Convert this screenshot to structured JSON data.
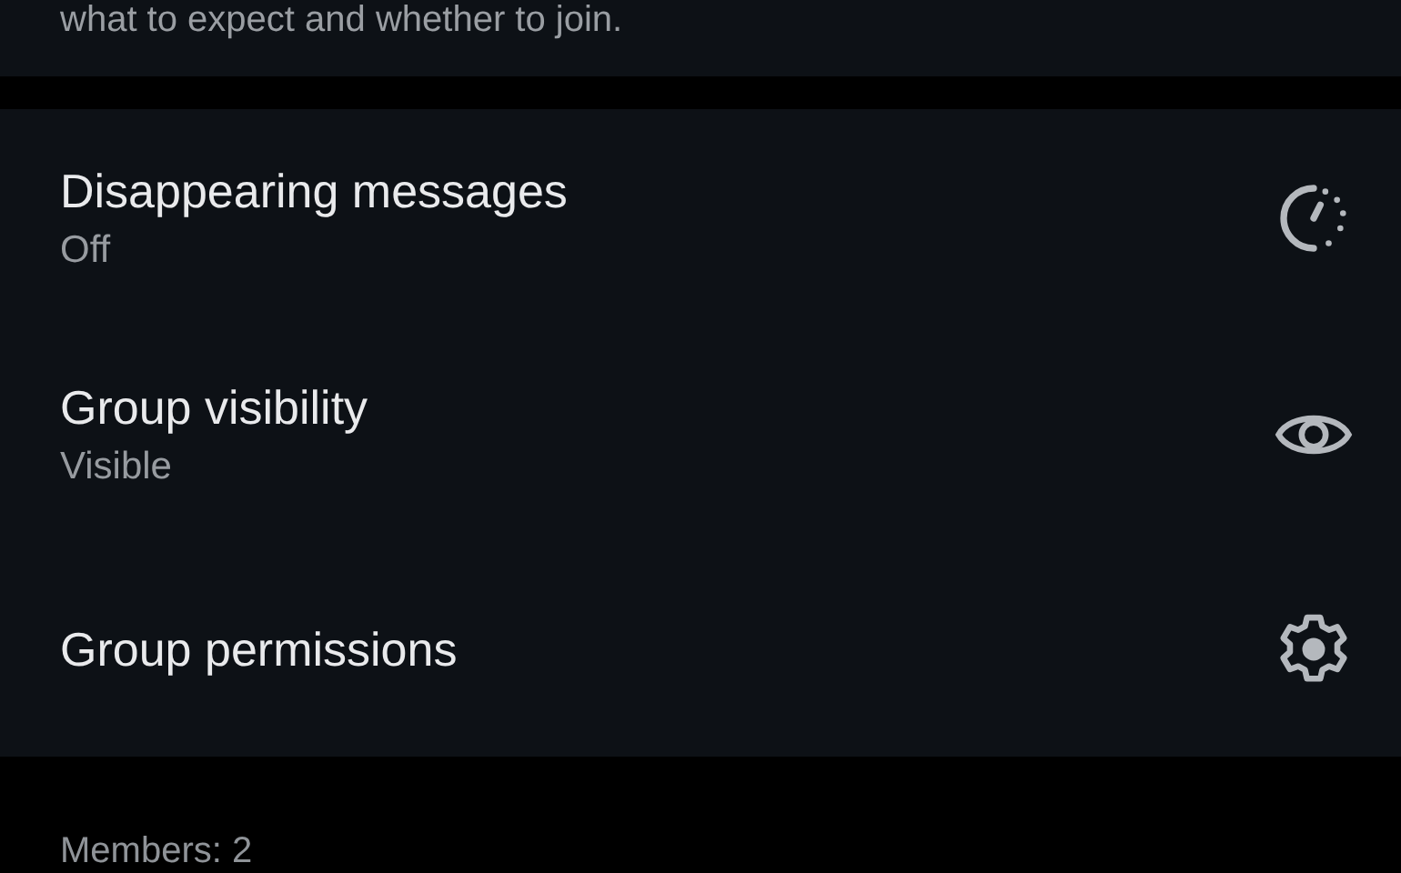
{
  "description": {
    "text": "what to expect and whether to join."
  },
  "settings": [
    {
      "kind": "timer",
      "title": "Disappearing messages",
      "value": "Off"
    },
    {
      "kind": "visibility",
      "title": "Group visibility",
      "value": "Visible"
    },
    {
      "kind": "permissions",
      "title": "Group permissions"
    }
  ],
  "members": {
    "label": "Members: 2"
  }
}
